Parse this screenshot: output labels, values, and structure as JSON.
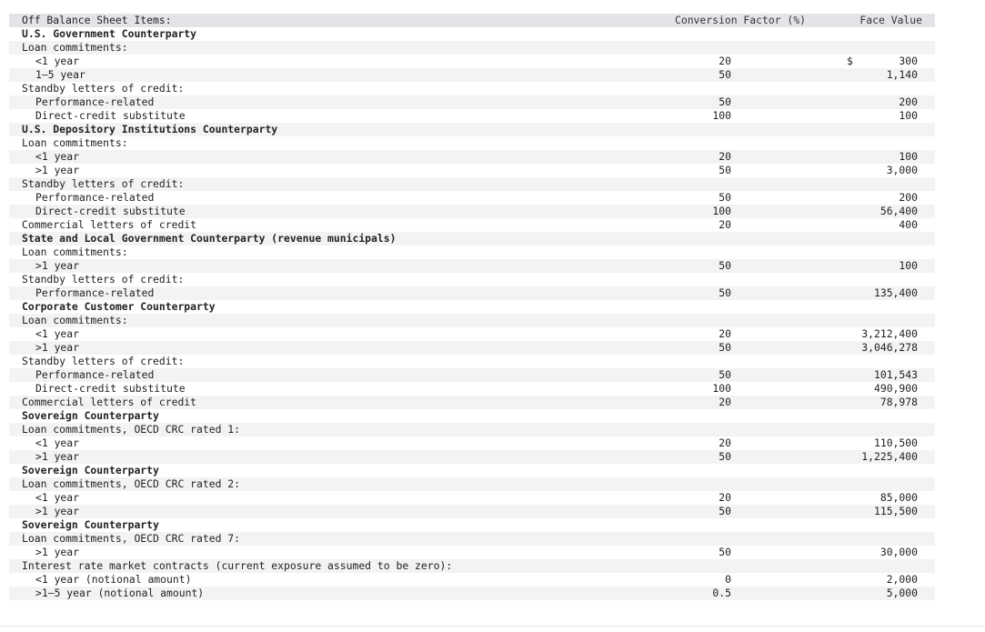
{
  "header": {
    "items_label": "Off Balance Sheet Items:",
    "conversion_label": "Conversion Factor (%)",
    "face_value_label": "Face Value"
  },
  "rows": [
    {
      "label": "U.S. Government Counterparty",
      "style": "section",
      "cf": "",
      "fv": ""
    },
    {
      "label": "Loan commitments:",
      "style": "group",
      "cf": "",
      "fv": ""
    },
    {
      "label": "<1 year",
      "style": "item",
      "cf": "20",
      "fv": "300",
      "dollar": "$"
    },
    {
      "label": "1–5 year",
      "style": "item",
      "cf": "50",
      "fv": "1,140"
    },
    {
      "label": "Standby letters of credit:",
      "style": "group",
      "cf": "",
      "fv": ""
    },
    {
      "label": "Performance-related",
      "style": "item",
      "cf": "50",
      "fv": "200"
    },
    {
      "label": "Direct-credit substitute",
      "style": "item",
      "cf": "100",
      "fv": "100"
    },
    {
      "label": "U.S. Depository Institutions Counterparty",
      "style": "section",
      "cf": "",
      "fv": ""
    },
    {
      "label": "Loan commitments:",
      "style": "group",
      "cf": "",
      "fv": ""
    },
    {
      "label": "<1 year",
      "style": "item",
      "cf": "20",
      "fv": "100"
    },
    {
      "label": ">1 year",
      "style": "item",
      "cf": "50",
      "fv": "3,000"
    },
    {
      "label": "Standby letters of credit:",
      "style": "group",
      "cf": "",
      "fv": ""
    },
    {
      "label": "Performance-related",
      "style": "item",
      "cf": "50",
      "fv": "200"
    },
    {
      "label": "Direct-credit substitute",
      "style": "item",
      "cf": "100",
      "fv": "56,400"
    },
    {
      "label": "Commercial letters of credit",
      "style": "group",
      "cf": "20",
      "fv": "400"
    },
    {
      "label": "State and Local Government Counterparty (revenue municipals)",
      "style": "section",
      "cf": "",
      "fv": ""
    },
    {
      "label": "Loan commitments:",
      "style": "group",
      "cf": "",
      "fv": ""
    },
    {
      "label": ">1 year",
      "style": "item",
      "cf": "50",
      "fv": "100"
    },
    {
      "label": "Standby letters of credit:",
      "style": "group",
      "cf": "",
      "fv": ""
    },
    {
      "label": "Performance-related",
      "style": "item",
      "cf": "50",
      "fv": "135,400"
    },
    {
      "label": "Corporate Customer Counterparty",
      "style": "section",
      "cf": "",
      "fv": ""
    },
    {
      "label": "Loan commitments:",
      "style": "group",
      "cf": "",
      "fv": ""
    },
    {
      "label": "<1 year",
      "style": "item",
      "cf": "20",
      "fv": "3,212,400"
    },
    {
      "label": ">1 year",
      "style": "item",
      "cf": "50",
      "fv": "3,046,278"
    },
    {
      "label": "Standby letters of credit:",
      "style": "group",
      "cf": "",
      "fv": ""
    },
    {
      "label": "Performance-related",
      "style": "item",
      "cf": "50",
      "fv": "101,543"
    },
    {
      "label": "Direct-credit substitute",
      "style": "item",
      "cf": "100",
      "fv": "490,900"
    },
    {
      "label": "Commercial letters of credit",
      "style": "group",
      "cf": "20",
      "fv": "78,978"
    },
    {
      "label": "Sovereign Counterparty",
      "style": "section",
      "cf": "",
      "fv": ""
    },
    {
      "label": "Loan commitments, OECD CRC rated 1:",
      "style": "group",
      "cf": "",
      "fv": ""
    },
    {
      "label": "<1 year",
      "style": "item",
      "cf": "20",
      "fv": "110,500"
    },
    {
      "label": ">1 year",
      "style": "item",
      "cf": "50",
      "fv": "1,225,400"
    },
    {
      "label": "Sovereign Counterparty",
      "style": "section",
      "cf": "",
      "fv": ""
    },
    {
      "label": "Loan commitments, OECD CRC rated 2:",
      "style": "group",
      "cf": "",
      "fv": ""
    },
    {
      "label": "<1 year",
      "style": "item",
      "cf": "20",
      "fv": "85,000"
    },
    {
      "label": ">1 year",
      "style": "item",
      "cf": "50",
      "fv": "115,500"
    },
    {
      "label": "Sovereign Counterparty",
      "style": "section",
      "cf": "",
      "fv": ""
    },
    {
      "label": "Loan commitments, OECD CRC rated 7:",
      "style": "group",
      "cf": "",
      "fv": ""
    },
    {
      "label": ">1 year",
      "style": "item",
      "cf": "50",
      "fv": "30,000"
    },
    {
      "label": "Interest rate market contracts (current exposure assumed to be zero):",
      "style": "group",
      "cf": "",
      "fv": ""
    },
    {
      "label": "<1 year (notional amount)",
      "style": "item",
      "cf": "0",
      "fv": "2,000"
    },
    {
      "label": ">1–5 year (notional amount)",
      "style": "item",
      "cf": "0.5",
      "fv": "5,000"
    }
  ]
}
